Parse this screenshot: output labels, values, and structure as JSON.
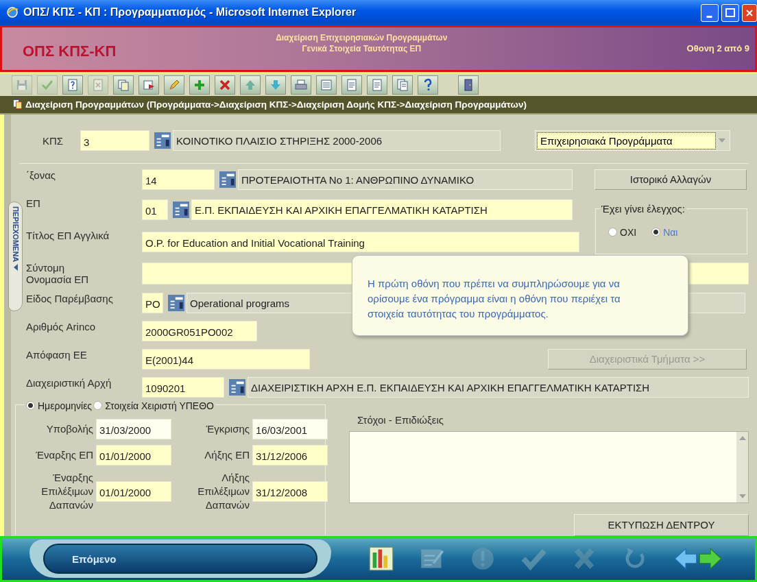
{
  "window": {
    "title": "ΟΠΣ/ ΚΠΣ - ΚΠ : Προγραμματισμός - Microsoft Internet Explorer"
  },
  "header": {
    "app_name": "ΟΠΣ ΚΠΣ-ΚΠ",
    "subtitle_lines": [
      "Διαχείριση Επιχειρησιακών Προγραμμάτων",
      "Γενικά Στοιχεία Ταυτότητας ΕΠ"
    ],
    "screen_counter": "Οθονη 2 από 9"
  },
  "toolbar": [
    {
      "kind": "save",
      "disabled": true
    },
    {
      "kind": "check",
      "disabled": true
    },
    {
      "kind": "help",
      "disabled": false
    },
    {
      "kind": "cancel",
      "disabled": true
    },
    {
      "kind": "copy",
      "disabled": false
    },
    {
      "kind": "flag",
      "disabled": false
    },
    {
      "kind": "pencil",
      "disabled": false
    },
    {
      "kind": "add",
      "disabled": false
    },
    {
      "kind": "delete",
      "disabled": false
    },
    {
      "kind": "up",
      "disabled": false
    },
    {
      "kind": "down",
      "disabled": false
    },
    {
      "kind": "print",
      "disabled": false
    },
    {
      "kind": "list",
      "disabled": false
    },
    {
      "kind": "doc",
      "disabled": false
    },
    {
      "kind": "doc",
      "disabled": false
    },
    {
      "kind": "docs",
      "disabled": false
    },
    {
      "kind": "question",
      "disabled": false
    },
    {
      "kind": "exit",
      "disabled": false
    }
  ],
  "breadcrumb": "Διαχείριση Προγραμμάτων (Προγράμματα->Διαχείριση ΚΠΣ->Διαχείριση Δομής ΚΠΣ->Διαχείριση Προγραμμάτων)",
  "side_tab": {
    "label": "ΠΕΡΙΕΧΟΜΕΝΑ"
  },
  "kps": {
    "label": "ΚΠΣ",
    "value": "3",
    "description": "ΚΟΙΝΟΤΙΚΟ ΠΛΑΙΣΙΟ ΣΤΗΡΙΞΗΣ 2000-2006"
  },
  "category_select": {
    "value": "Επιχειρησιακά Προγράμματα"
  },
  "axis": {
    "label": "΄ξονας",
    "value": "14",
    "description": "ΠΡΟΤΕΡΑΙΟΤΗΤΑ Νο 1: ΑΝΘΡΩΠΙΝΟ ΔΥΝΑΜΙΚΟ"
  },
  "history_button": "Ιστορικό Αλλαγών",
  "op": {
    "label": "ΕΠ",
    "value": "01",
    "description": "Ε.Π. ΕΚΠΑΙΔΕΥΣΗ ΚΑΙ ΑΡΧΙΚΗ ΕΠΑΓΓΕΛΜΑΤΙΚΗ  ΚΑΤΑΡΤΙΣΗ"
  },
  "checked_group": {
    "legend": "Έχει γίνει έλεγχος:",
    "options": [
      {
        "label": "ΟΧΙ",
        "selected": false
      },
      {
        "label": "Ναι",
        "selected": true
      }
    ]
  },
  "title_en": {
    "label": "Τίτλος ΕΠ Αγγλικά",
    "value": "O.P. for Education and Initial Vocational Training"
  },
  "short_name": {
    "label": "Σύντομη Ονομασία ΕΠ"
  },
  "intervention": {
    "label": "Είδος Παρέμβασης",
    "value": "PO",
    "description": "Operational programs"
  },
  "arinco": {
    "label": "Αριθμός Arinco",
    "value": "2000GR051PO002"
  },
  "ec_decision": {
    "label": "Απόφαση ΕΕ",
    "value": "E(2001)44"
  },
  "departments_button": {
    "label": "Διαχειριστικά Τμήματα >>",
    "disabled": true
  },
  "managing_authority": {
    "label": "Διαχειριστική Αρχή",
    "value": "1090201",
    "description": "ΔΙΑΧΕΙΡΙΣΤΙΚΗ ΑΡΧΗ Ε.Π. ΕΚΠΑΙΔΕΥΣΗ ΚΑΙ ΑΡΧΙΚΗ ΕΠΑΓΓΕΛΜΑΤΙΚΗ  ΚΑΤΑΡΤΙΣΗ"
  },
  "date_panel": {
    "modes": [
      {
        "label": "Ημερομηνίες",
        "selected": true
      },
      {
        "label": "Στοιχεία Χειριστή ΥΠΕΘΟ",
        "selected": false
      }
    ],
    "fields": [
      {
        "label": "Υποβολής",
        "value": "31/03/2000",
        "highlighted": false
      },
      {
        "label": "Έγκρισης",
        "value": "16/03/2001",
        "highlighted": false
      },
      {
        "label": "Έναρξης ΕΠ",
        "value": "01/01/2000",
        "highlighted": true
      },
      {
        "label": "Λήξης ΕΠ",
        "value": "31/12/2006",
        "highlighted": true
      },
      {
        "label": "Έναρξης Επιλέξιμων Δαπανών",
        "value": "01/01/2000",
        "highlighted": true
      },
      {
        "label": "Λήξης Επιλέξιμων Δαπανών",
        "value": "31/12/2008",
        "highlighted": true
      }
    ]
  },
  "objectives": {
    "label": "Στόχοι - Επιδιώξεις"
  },
  "print_tree_button": "ΕΚΤΥΠΩΣΗ ΔΕΝΤΡΟΥ",
  "tooltip": "Η πρώτη οθόνη που πρέπει να συμπληρώσουμε για να ορίσουμε ένα πρόγραμμα είναι η οθόνη που περιέχει τα στοιχεία ταυτότητας του προγράμματος.",
  "footer": {
    "next_button": "Επόμενο",
    "actions": [
      {
        "kind": "chart",
        "disabled": false
      },
      {
        "kind": "edit",
        "disabled": true
      },
      {
        "kind": "alert",
        "disabled": true
      },
      {
        "kind": "check",
        "disabled": true
      },
      {
        "kind": "cross",
        "disabled": true
      },
      {
        "kind": "refresh",
        "disabled": true
      },
      {
        "kind": "back",
        "disabled": false
      },
      {
        "kind": "forward",
        "disabled": false
      }
    ]
  }
}
